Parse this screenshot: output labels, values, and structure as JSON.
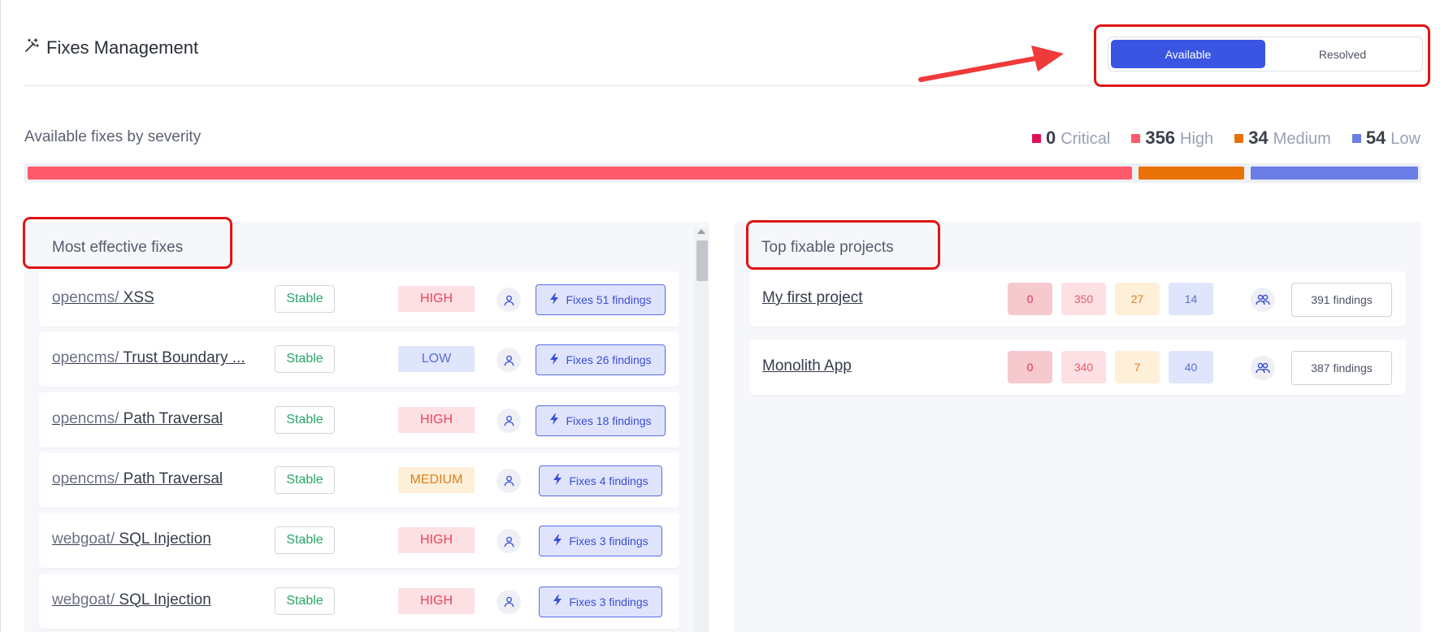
{
  "header": {
    "title": "Fixes Management",
    "toggle": {
      "available": "Available",
      "resolved": "Resolved",
      "selected": "Available"
    }
  },
  "severity": {
    "title": "Available fixes by severity",
    "legend": [
      {
        "count": "0",
        "label": "Critical",
        "color": "#e0105a"
      },
      {
        "count": "356",
        "label": "High",
        "color": "#ff5a6a"
      },
      {
        "count": "34",
        "label": "Medium",
        "color": "#e87205"
      },
      {
        "count": "54",
        "label": "Low",
        "color": "#6b7de6"
      }
    ]
  },
  "fixes": {
    "title": "Most effective fixes",
    "items": [
      {
        "repo": "opencms/",
        "name": "XSS",
        "status": "Stable",
        "severity": "HIGH",
        "action": "Fixes 51 findings"
      },
      {
        "repo": "opencms/",
        "name": "Trust Boundary ...",
        "status": "Stable",
        "severity": "LOW",
        "action": "Fixes 26 findings"
      },
      {
        "repo": "opencms/",
        "name": "Path Traversal",
        "status": "Stable",
        "severity": "HIGH",
        "action": "Fixes 18 findings"
      },
      {
        "repo": "opencms/",
        "name": "Path Traversal",
        "status": "Stable",
        "severity": "MEDIUM",
        "action": "Fixes 4 findings"
      },
      {
        "repo": "webgoat/",
        "name": "SQL Injection",
        "status": "Stable",
        "severity": "HIGH",
        "action": "Fixes 3 findings"
      },
      {
        "repo": "webgoat/",
        "name": "SQL Injection",
        "status": "Stable",
        "severity": "HIGH",
        "action": "Fixes 3 findings"
      }
    ]
  },
  "projects": {
    "title": "Top fixable projects",
    "items": [
      {
        "name": "My first project",
        "critical": "0",
        "high": "350",
        "medium": "27",
        "low": "14",
        "findings": "391 findings"
      },
      {
        "name": "Monolith App",
        "critical": "0",
        "high": "340",
        "medium": "7",
        "low": "40",
        "findings": "387 findings"
      }
    ]
  }
}
